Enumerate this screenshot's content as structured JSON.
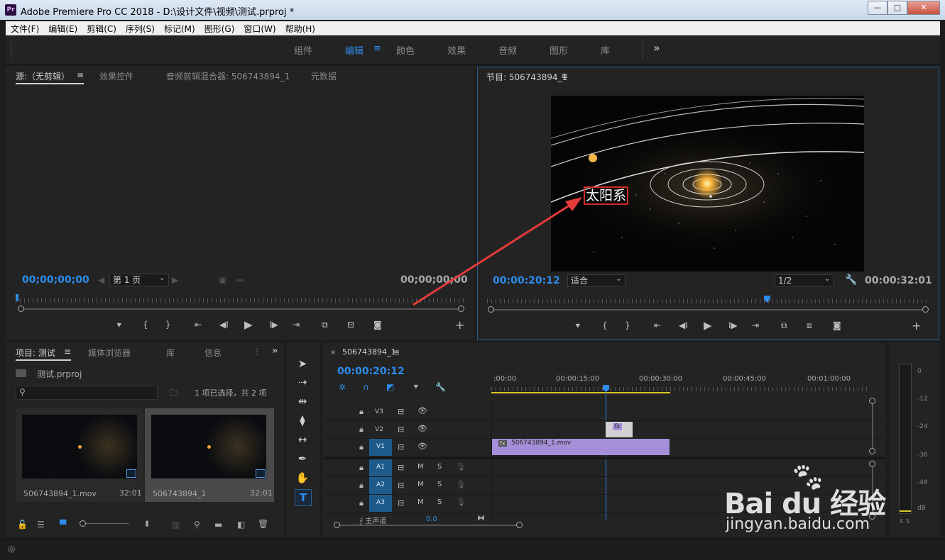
{
  "window": {
    "app_icon": "Pr",
    "title": "Adobe Premiere Pro CC 2018 - D:\\设计文件\\视频\\测试.prproj *",
    "minimize": "—",
    "maximize": "□",
    "close": "✕"
  },
  "menu": [
    "文件(F)",
    "编辑(E)",
    "剪辑(C)",
    "序列(S)",
    "标记(M)",
    "图形(G)",
    "窗口(W)",
    "帮助(H)"
  ],
  "workspaces": {
    "tabs": [
      "组件",
      "编辑",
      "颜色",
      "效果",
      "音频",
      "图形",
      "库"
    ],
    "active": "编辑",
    "overflow": "»"
  },
  "source_panel": {
    "tabs": [
      "源:（无剪辑）",
      "效果控件",
      "音频剪辑混合器: 506743894_1",
      "元数据"
    ],
    "timecode_in": "00;00;00;00",
    "timecode_out": "00;00;00;00",
    "page_select": "第 1 页"
  },
  "program_panel": {
    "title": "节目: 506743894_1",
    "timecode": "00:00:20:12",
    "fit_select": "适合",
    "resolution_select": "1/2",
    "duration": "00:00:32:01",
    "overlay_text": "太阳系"
  },
  "project_panel": {
    "tabs": [
      "项目: 测试",
      "媒体浏览器",
      "库",
      "信息"
    ],
    "file_name": "测试.prproj",
    "search_placeholder": "",
    "selection_info": "1 项已选择，共 2 项",
    "items": [
      {
        "name": "506743894_1.mov",
        "duration": "32:01"
      },
      {
        "name": "506743894_1",
        "duration": "32:01"
      }
    ]
  },
  "timeline": {
    "sequence_tab": "506743894_1",
    "timecode": "00:00:20:12",
    "ruler_labels": [
      ":00:00",
      "00:00:15:00",
      "00:00:30:00",
      "00:00:45:00",
      "00:01:00:00"
    ],
    "video_tracks": [
      "V3",
      "V2",
      "V1"
    ],
    "audio_tracks": [
      "A1",
      "A2",
      "A3"
    ],
    "master_label": "主声道",
    "master_value": "0.0",
    "clip_name": "506743894_1.mov",
    "fx_label": "fx",
    "track_buttons": {
      "mute": "M",
      "solo": "S"
    }
  },
  "audio_meter": {
    "labels": [
      "0",
      "-12",
      "-24",
      "-36",
      "-48",
      "dB"
    ],
    "solo_buttons": [
      "S",
      "S"
    ]
  },
  "watermark": {
    "brand": "Bai du 经验",
    "url": "jingyan.baidu.com"
  },
  "colors": {
    "accent_blue": "#2d8ceb",
    "clip_purple": "#a48fd8",
    "annotation_red": "#e33b3b",
    "panel_bg": "#232323"
  }
}
